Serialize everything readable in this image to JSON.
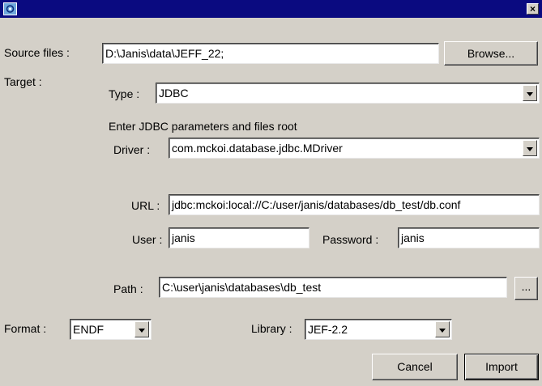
{
  "window": {
    "close_glyph": "×",
    "icon": "java-cup-icon"
  },
  "source_files": {
    "label": "Source files :",
    "value": "D:\\Janis\\data\\JEFF_22;",
    "browse_label": "Browse..."
  },
  "target": {
    "label": "Target :",
    "type_label": "Type :",
    "type_value": "JDBC",
    "hint": "Enter JDBC parameters and files root"
  },
  "jdbc": {
    "driver_label": "Driver :",
    "driver_value": "com.mckoi.database.jdbc.MDriver",
    "url_label": "URL :",
    "url_value": "jdbc:mckoi:local://C:/user/janis/databases/db_test/db.conf",
    "user_label": "User :",
    "user_value": "janis",
    "password_label": "Password :",
    "password_value": "janis"
  },
  "path": {
    "label": "Path :",
    "value": "C:\\user\\janis\\databases\\db_test",
    "browse_label": "..."
  },
  "format": {
    "label": "Format :",
    "value": "ENDF"
  },
  "library": {
    "label": "Library :",
    "value": "JEF-2.2"
  },
  "actions": {
    "cancel_label": "Cancel",
    "import_label": "Import"
  }
}
